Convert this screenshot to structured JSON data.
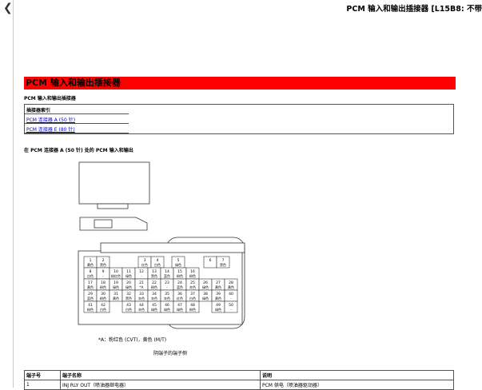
{
  "header": {
    "back_icon": "chevron-left-icon",
    "title": "PCM 输入和输出插接器 [L15B8: 不带"
  },
  "section": {
    "banner": "PCM 输入和输出插接器",
    "subtitle": "PCM 输入和输出插接器"
  },
  "connector_index": {
    "heading": "插接器索引",
    "links": [
      "PCM 连接器 A (50 针)",
      "PCM 连接器 E (80 针)"
    ]
  },
  "io_section_title": "在 PCM 连接器 A (50 针) 处的 PCM 输入和输出",
  "pins_row1": [
    {
      "num": "1",
      "color": "黄色"
    },
    {
      "num": "2",
      "color": "黑色"
    },
    {
      "num": "3",
      "color": "红色"
    },
    {
      "num": "4",
      "color": "白色"
    },
    {
      "num": "5",
      "color": "绿色"
    },
    {
      "num": "6",
      "color": ""
    },
    {
      "num": "7",
      "color": "黑色"
    }
  ],
  "pins_row2": [
    {
      "num": "8",
      "color": "白色"
    },
    {
      "num": "9",
      "color": "-"
    },
    {
      "num": "10",
      "color": "粉红色"
    },
    {
      "num": "11",
      "color": "绿色"
    },
    {
      "num": "12",
      "color": "-"
    },
    {
      "num": "13",
      "color": "黑色"
    },
    {
      "num": "14",
      "color": "蓝色"
    },
    {
      "num": "15",
      "color": "粉色"
    },
    {
      "num": "16",
      "color": "粉色"
    }
  ],
  "pins_row3": [
    {
      "num": "17",
      "color": "黄色"
    },
    {
      "num": "18",
      "color": "粉色"
    },
    {
      "num": "19",
      "color": "绿色"
    },
    {
      "num": "20",
      "color": "绿色"
    },
    {
      "num": "21",
      "color": "*A"
    },
    {
      "num": "22",
      "color": "粉色"
    },
    {
      "num": "23",
      "color": "-"
    },
    {
      "num": "24",
      "color": "蓝色"
    },
    {
      "num": "25",
      "color": "灰色"
    },
    {
      "num": "26",
      "color": "绿色"
    },
    {
      "num": "27",
      "color": "黄色"
    },
    {
      "num": "28",
      "color": "黄色"
    }
  ],
  "pins_row4": [
    {
      "num": "29",
      "color": "蓝色"
    },
    {
      "num": "30",
      "color": "粉色"
    },
    {
      "num": "31",
      "color": "黄色"
    },
    {
      "num": "32",
      "color": "黑色"
    },
    {
      "num": "33",
      "color": "灰色"
    },
    {
      "num": "34",
      "color": "灰色"
    },
    {
      "num": "35",
      "color": "灰色"
    },
    {
      "num": "36",
      "color": "红色"
    },
    {
      "num": "37",
      "color": "白色"
    },
    {
      "num": "38",
      "color": "绿色"
    },
    {
      "num": "39",
      "color": "黄色"
    },
    {
      "num": "40",
      "color": "-"
    }
  ],
  "pins_row5": [
    {
      "num": "41",
      "color": "粉色"
    },
    {
      "num": "42",
      "color": "白色"
    },
    {
      "num": "43",
      "color": "白色"
    },
    {
      "num": "44",
      "color": "灰色"
    },
    {
      "num": "45",
      "color": "绿色"
    },
    {
      "num": "46",
      "color": "绿色"
    },
    {
      "num": "47",
      "color": "绿色"
    },
    {
      "num": "48",
      "color": "粉色"
    },
    {
      "num": "49",
      "color": "绿色"
    },
    {
      "num": "50",
      "color": "-"
    }
  ],
  "footnote": "*A：粉红色 (CVT)，黄色 (M/T)",
  "caption": "阴端子的端子侧",
  "table": {
    "headers": [
      "端子号",
      "端子名称",
      "说明"
    ],
    "rows": [
      [
        "1",
        "INJ RLY OUT（喷油器继电器）",
        "PCM 供电（喷油器驱动器）"
      ]
    ]
  },
  "colors": {
    "banner": "#ff0000",
    "link": "#0000cc"
  }
}
